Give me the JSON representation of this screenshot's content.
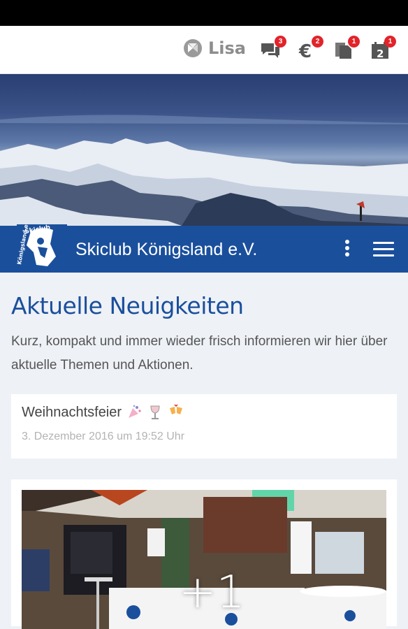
{
  "topbar": {
    "user_name": "Lisa",
    "icons": [
      {
        "name": "chat-icon",
        "badge": "3"
      },
      {
        "name": "euro-icon",
        "badge": "2"
      },
      {
        "name": "documents-icon",
        "badge": "1"
      },
      {
        "name": "calendar-icon",
        "badge": "1",
        "day": "2"
      }
    ]
  },
  "brand": {
    "title": "Skiclub Königsland e.V.",
    "logo_text_top": "Skiclub",
    "logo_text_side": "Königsland e.V."
  },
  "news": {
    "heading": "Aktuelle Neuigkeiten",
    "intro": "Kurz, kompakt und immer wieder frisch informieren wir hier über aktuelle Themen und Aktionen."
  },
  "posts": [
    {
      "title": "Weihnachtsfeier",
      "date": "3. Dezember 2016 um 19:52 Uhr"
    }
  ],
  "gallery": {
    "more_count": "+1"
  },
  "colors": {
    "brand_blue": "#1a4f9c",
    "badge_red": "#e2232a"
  }
}
